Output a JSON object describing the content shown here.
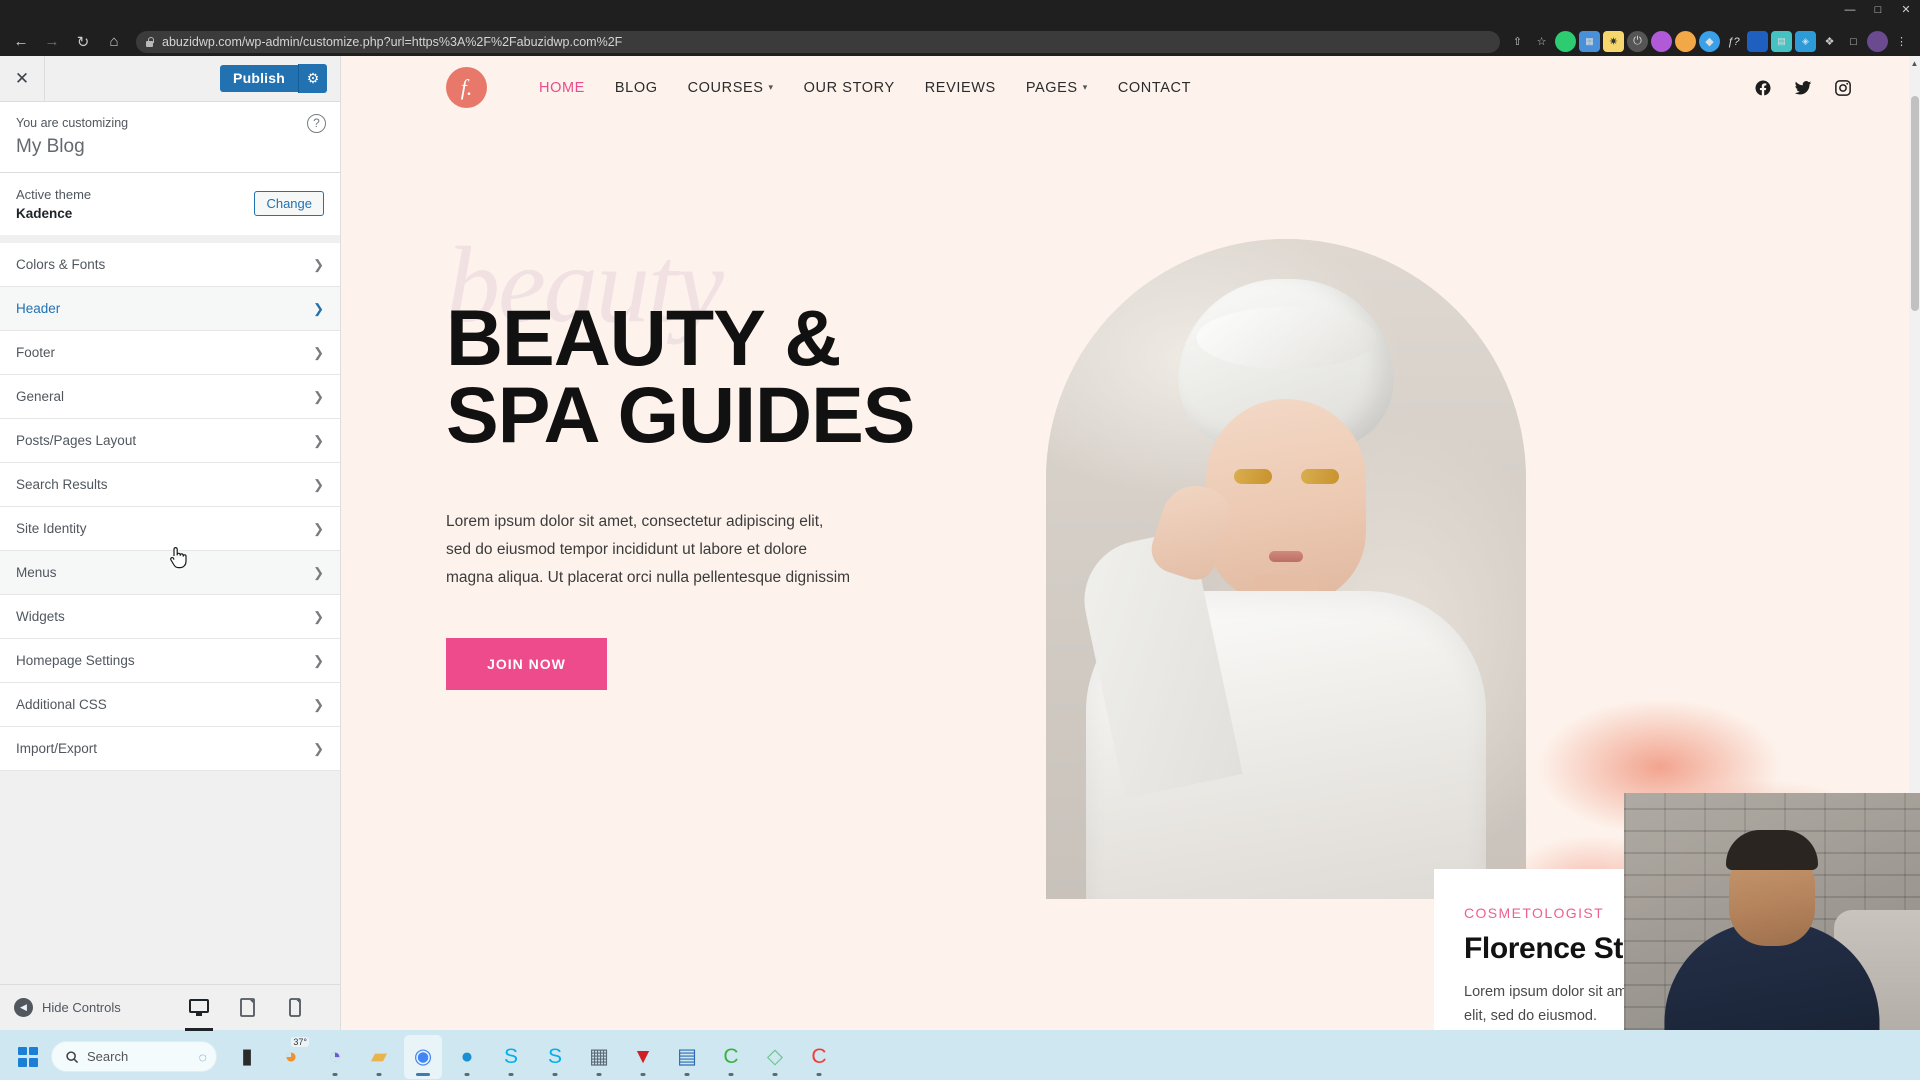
{
  "browser": {
    "url": "abuzidwp.com/wp-admin/customize.php?url=https%3A%2F%2Fabuzidwp.com%2F",
    "back_icon": "back-arrow-icon",
    "forward_icon": "forward-arrow-icon",
    "reload_icon": "reload-icon",
    "home_icon": "home-icon",
    "lock_icon": "lock-icon",
    "share_icon": "share-icon",
    "star_icon": "bookmark-star-icon",
    "extensions": [
      "●",
      "▣",
      "✹",
      "⏻",
      "◐",
      "●",
      "◆",
      "ƒ?",
      "■",
      "▤",
      "◈",
      "❖",
      "□"
    ],
    "profile_icon": "profile-avatar-icon",
    "menu_icon": "chrome-menu-icon",
    "minimize": "—",
    "maximize": "□",
    "close": "✕"
  },
  "customizer": {
    "close_label": "✕",
    "publish_label": "Publish",
    "gear_label": "⚙",
    "help_label": "?",
    "customizing_label": "You are customizing",
    "site_title": "My Blog",
    "active_theme_label": "Active theme",
    "theme_name": "Kadence",
    "change_label": "Change",
    "panels": [
      {
        "label": "Colors & Fonts",
        "state": "normal"
      },
      {
        "label": "Header",
        "state": "active"
      },
      {
        "label": "Footer",
        "state": "normal"
      },
      {
        "label": "General",
        "state": "normal"
      },
      {
        "label": "Posts/Pages Layout",
        "state": "normal"
      },
      {
        "label": "Search Results",
        "state": "normal"
      },
      {
        "label": "Site Identity",
        "state": "normal"
      },
      {
        "label": "Menus",
        "state": "hovered"
      },
      {
        "label": "Widgets",
        "state": "normal"
      },
      {
        "label": "Homepage Settings",
        "state": "normal"
      },
      {
        "label": "Additional CSS",
        "state": "normal"
      },
      {
        "label": "Import/Export",
        "state": "normal"
      }
    ],
    "footer": {
      "hide_controls_label": "Hide Controls",
      "desktop_icon": "desktop-preview-icon",
      "tablet_icon": "tablet-preview-icon",
      "mobile_icon": "mobile-preview-icon"
    },
    "accent_color": "#2271b1"
  },
  "site": {
    "logo_glyph": "f.",
    "logo_color": "#e8796a",
    "menu": [
      {
        "label": "HOME",
        "active": true,
        "caret": false
      },
      {
        "label": "BLOG",
        "active": false,
        "caret": false
      },
      {
        "label": "COURSES",
        "active": false,
        "caret": true
      },
      {
        "label": "OUR STORY",
        "active": false,
        "caret": false
      },
      {
        "label": "REVIEWS",
        "active": false,
        "caret": false
      },
      {
        "label": "PAGES",
        "active": false,
        "caret": true
      },
      {
        "label": "CONTACT",
        "active": false,
        "caret": false
      }
    ],
    "socials": [
      "facebook-icon",
      "twitter-icon",
      "instagram-icon"
    ],
    "hero": {
      "watermark": "beauty",
      "title_line1": "BEAUTY &",
      "title_line2": "SPA GUIDES",
      "paragraph": "Lorem ipsum dolor sit amet, consectetur adipiscing elit, sed do eiusmod tempor incididunt ut labore et dolore magna aliqua. Ut placerat orci nulla pellentesque dignissim",
      "cta_label": "JOIN NOW",
      "cta_color": "#ee4b8c"
    },
    "person_card": {
      "kicker": "COSMETOLOGIST",
      "name": "Florence Stewart",
      "description": "Lorem ipsum dolor sit amet, consectetur adipiscing elit, sed do eiusmod.",
      "kicker_color": "#ee5f92"
    },
    "background_color": "#fdf3ec"
  },
  "taskbar": {
    "start_icon": "windows-start-icon",
    "search_placeholder": "Search",
    "search_icon": "search-icon",
    "copilot_icon": "copilot-icon",
    "weather_temp": "37°",
    "items": [
      {
        "name": "file-explorer-dark-icon",
        "glyph": "▮",
        "color": "#2b2b2b",
        "running": false
      },
      {
        "name": "weather-icon",
        "glyph": "◕",
        "color": "#f0922b",
        "running": false
      },
      {
        "name": "zoom-icon",
        "glyph": "◔",
        "color": "#6b5bd6",
        "running": true
      },
      {
        "name": "folder-icon",
        "glyph": "▰",
        "color": "#e9b44c",
        "running": true
      },
      {
        "name": "chrome-icon",
        "glyph": "◉",
        "color": "#4285f4",
        "running": true
      },
      {
        "name": "edge-icon",
        "glyph": "●",
        "color": "#1a8fd1",
        "running": true
      },
      {
        "name": "skype-icon",
        "glyph": "S",
        "color": "#00aff0",
        "running": true
      },
      {
        "name": "skype-alt-icon",
        "glyph": "S",
        "color": "#00aff0",
        "running": true
      },
      {
        "name": "calculator-icon",
        "glyph": "▦",
        "color": "#5c6b78",
        "running": true
      },
      {
        "name": "shield-icon",
        "glyph": "▼",
        "color": "#cf2027",
        "running": true
      },
      {
        "name": "notes-icon",
        "glyph": "▤",
        "color": "#2d6cb5",
        "running": true
      },
      {
        "name": "calendar-green-icon",
        "glyph": "C",
        "color": "#3bb143",
        "running": true
      },
      {
        "name": "diamond-icon",
        "glyph": "◇",
        "color": "#6dc48f",
        "running": true
      },
      {
        "name": "camtasia-icon",
        "glyph": "C",
        "color": "#ef3e36",
        "running": true
      }
    ]
  }
}
